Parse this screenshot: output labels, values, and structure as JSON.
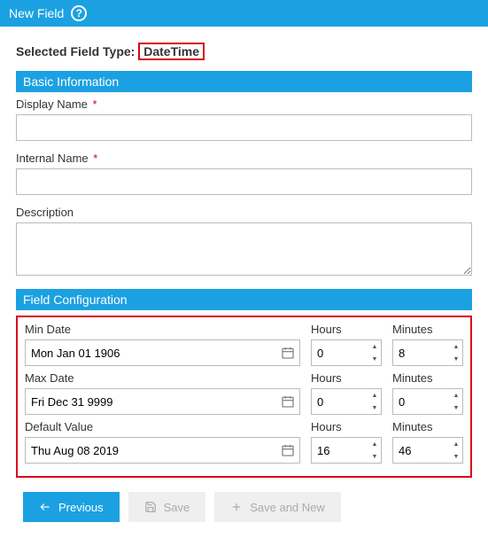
{
  "header": {
    "title": "New Field"
  },
  "selected": {
    "label": "Selected Field Type:",
    "value": "DateTime"
  },
  "sections": {
    "basic": {
      "title": "Basic Information"
    },
    "config": {
      "title": "Field Configuration"
    }
  },
  "basic": {
    "displayName": {
      "label": "Display Name",
      "value": ""
    },
    "internalName": {
      "label": "Internal Name",
      "value": ""
    },
    "description": {
      "label": "Description",
      "value": ""
    }
  },
  "config": {
    "minDate": {
      "label": "Min Date",
      "value": "Mon Jan 01 1906",
      "hoursLabel": "Hours",
      "hours": "0",
      "minutesLabel": "Minutes",
      "minutes": "8"
    },
    "maxDate": {
      "label": "Max Date",
      "value": "Fri Dec 31 9999",
      "hoursLabel": "Hours",
      "hours": "0",
      "minutesLabel": "Minutes",
      "minutes": "0"
    },
    "defaultValue": {
      "label": "Default Value",
      "value": "Thu Aug 08 2019",
      "hoursLabel": "Hours",
      "hours": "16",
      "minutesLabel": "Minutes",
      "minutes": "46"
    }
  },
  "buttons": {
    "previous": "Previous",
    "save": "Save",
    "saveAndNew": "Save and New"
  }
}
